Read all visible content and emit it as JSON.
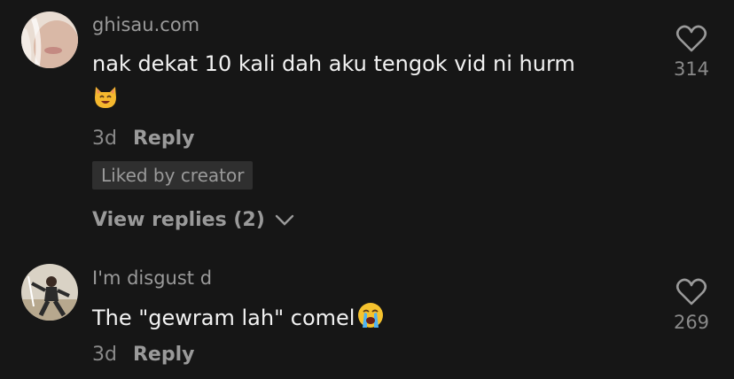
{
  "comments": [
    {
      "username": "ghisau.com",
      "text": "nak dekat 10 kali dah aku tengok vid ni hurm",
      "emoji": "smiling-cat-emoji",
      "time": "3d",
      "reply_label": "Reply",
      "liked_by_creator": "Liked by creator",
      "view_replies": "View replies (2)",
      "like_count": "314"
    },
    {
      "username": "I'm disgust d",
      "text": "The \"gewram lah\" comel",
      "emoji": "crying-face-emoji",
      "time": "3d",
      "reply_label": "Reply",
      "like_count": "269"
    }
  ],
  "colors": {
    "background": "#161616",
    "username": "#9a9a9a",
    "text": "#f2f2f2",
    "meta": "#8a8a8a",
    "badge": "#2f2f2f"
  }
}
